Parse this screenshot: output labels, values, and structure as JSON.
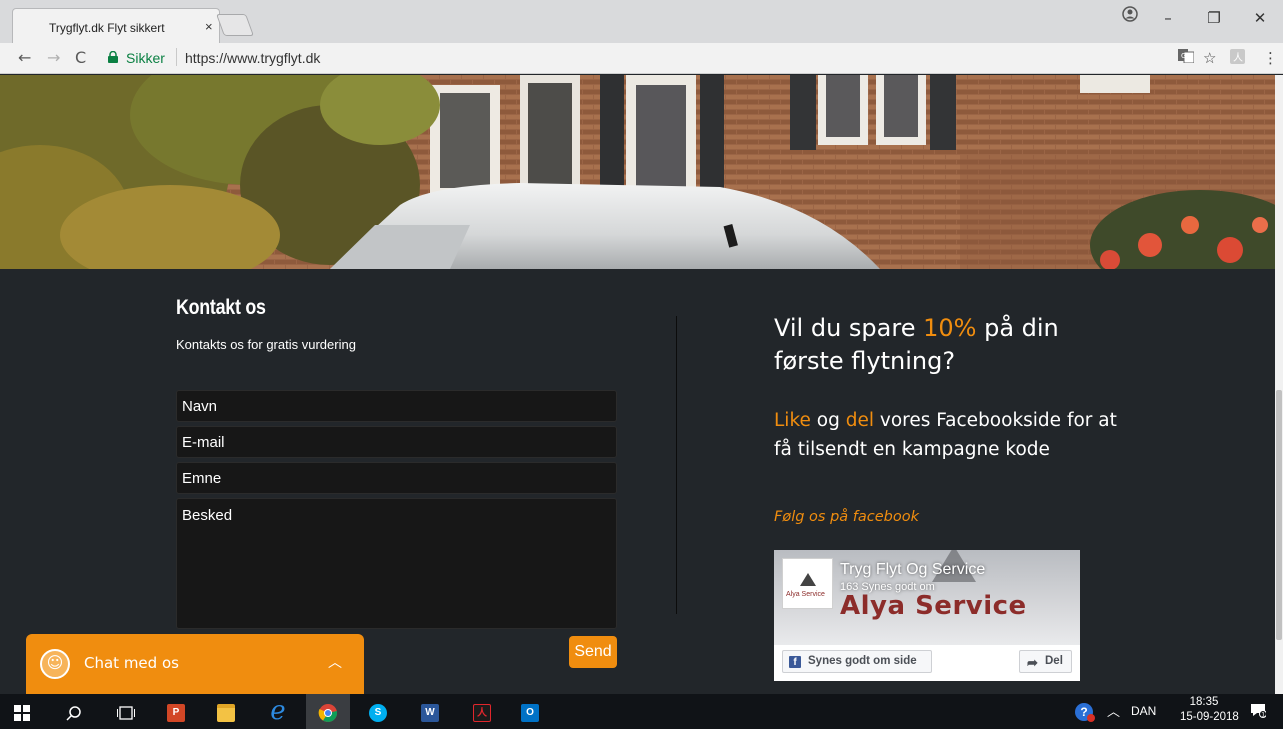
{
  "browser": {
    "tab_title": "Trygflyt.dk Flyt sikkert",
    "tab_close": "×",
    "secure_label": "Sikker",
    "url": "https://www.trygflyt.dk",
    "window_controls": {
      "minimize": "–",
      "maximize": "❐",
      "close": "✕"
    }
  },
  "contact": {
    "title": "Kontakt os",
    "subtitle": "Kontakts os for gratis vurdering",
    "fields": {
      "name_placeholder": "Navn",
      "email_placeholder": "E-mail",
      "subject_placeholder": "Emne",
      "message_placeholder": "Besked"
    },
    "send_label": "Send"
  },
  "promo": {
    "headline_pre": "Vil du spare ",
    "headline_highlight": "10%",
    "headline_post": " på din første flytning?",
    "body_like": "Like",
    "body_og": " og ",
    "body_del": "del",
    "body_rest": " vores Facebookside for at få tilsendt en kampagne kode",
    "follow_label": "Følg os på facebook",
    "accent_color": "#f08d0f"
  },
  "facebook_widget": {
    "page_name": "Tryg Flyt Og Service",
    "likes_text": "163 Synes godt om",
    "cover_brand": "Alya Service",
    "avatar_brand": "Alya Service",
    "like_button": "Synes godt om side",
    "share_button": "Del"
  },
  "chat": {
    "label": "Chat med os"
  },
  "taskbar": {
    "language": "DAN",
    "time": "18:35",
    "date": "15-09-2018",
    "icons": [
      "windows-icon",
      "search-icon",
      "task-view-icon",
      "powerpoint-icon",
      "file-explorer-icon",
      "internet-explorer-icon",
      "chrome-icon",
      "skype-icon",
      "word-icon",
      "acrobat-icon",
      "outlook-icon"
    ]
  }
}
